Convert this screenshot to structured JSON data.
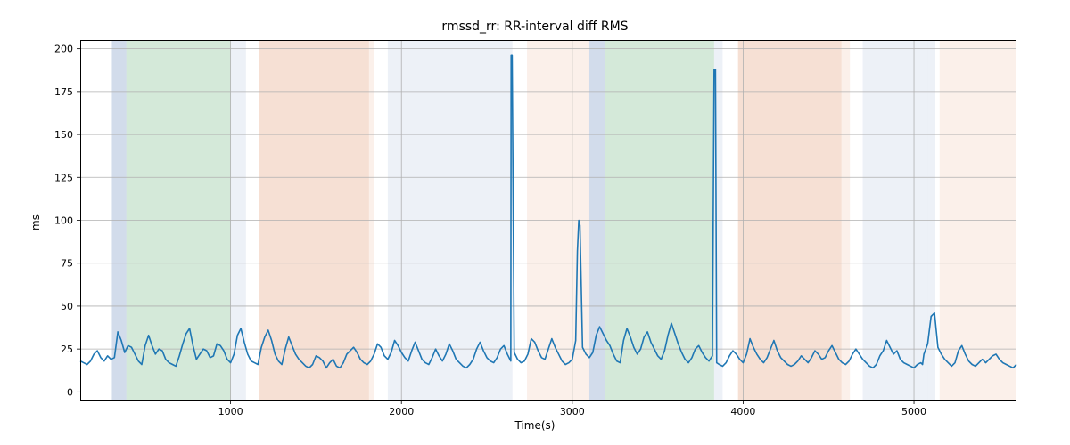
{
  "chart_data": {
    "type": "line",
    "title": "rmssd_rr: RR-interval diff RMS",
    "xlabel": "Time(s)",
    "ylabel": "ms",
    "xlim": [
      120,
      5600
    ],
    "ylim": [
      -5,
      205
    ],
    "xticks": [
      1000,
      2000,
      3000,
      4000,
      5000
    ],
    "yticks": [
      0,
      25,
      50,
      75,
      100,
      125,
      150,
      175,
      200
    ],
    "grid": true,
    "bands": [
      {
        "x0": 305,
        "x1": 390,
        "class": "band-blue"
      },
      {
        "x0": 390,
        "x1": 1000,
        "class": "band-green"
      },
      {
        "x0": 1000,
        "x1": 1090,
        "class": "band-lightblue"
      },
      {
        "x0": 1165,
        "x1": 1810,
        "class": "band-orange"
      },
      {
        "x0": 1810,
        "x1": 1840,
        "class": "band-lightorange"
      },
      {
        "x0": 1920,
        "x1": 2650,
        "class": "band-lightblue"
      },
      {
        "x0": 2735,
        "x1": 3100,
        "class": "band-lightorange"
      },
      {
        "x0": 3100,
        "x1": 3190,
        "class": "band-blue"
      },
      {
        "x0": 3190,
        "x1": 3830,
        "class": "band-green"
      },
      {
        "x0": 3830,
        "x1": 3880,
        "class": "band-lightblue"
      },
      {
        "x0": 3970,
        "x1": 4575,
        "class": "band-orange"
      },
      {
        "x0": 4575,
        "x1": 4625,
        "class": "band-lightorange"
      },
      {
        "x0": 4700,
        "x1": 5080,
        "class": "band-lightblue"
      },
      {
        "x0": 5080,
        "x1": 5125,
        "class": "band-lightblue"
      },
      {
        "x0": 5150,
        "x1": 5600,
        "class": "band-lightorange"
      }
    ],
    "series": [
      {
        "name": "rmssd_rr",
        "x": [
          120,
          140,
          160,
          180,
          200,
          220,
          240,
          260,
          280,
          300,
          320,
          340,
          360,
          380,
          400,
          420,
          440,
          460,
          480,
          500,
          520,
          540,
          560,
          580,
          600,
          620,
          640,
          660,
          680,
          700,
          720,
          740,
          760,
          780,
          800,
          820,
          840,
          860,
          880,
          900,
          920,
          940,
          960,
          980,
          1000,
          1020,
          1040,
          1060,
          1080,
          1100,
          1120,
          1140,
          1160,
          1180,
          1200,
          1220,
          1240,
          1260,
          1280,
          1300,
          1320,
          1340,
          1360,
          1380,
          1400,
          1420,
          1440,
          1460,
          1480,
          1500,
          1520,
          1540,
          1560,
          1580,
          1600,
          1620,
          1640,
          1660,
          1680,
          1700,
          1720,
          1740,
          1760,
          1780,
          1800,
          1820,
          1840,
          1860,
          1880,
          1900,
          1920,
          1940,
          1960,
          1980,
          2000,
          2020,
          2040,
          2060,
          2080,
          2100,
          2120,
          2140,
          2160,
          2180,
          2200,
          2220,
          2240,
          2260,
          2280,
          2300,
          2320,
          2340,
          2360,
          2380,
          2400,
          2420,
          2440,
          2460,
          2480,
          2500,
          2520,
          2540,
          2560,
          2580,
          2600,
          2620,
          2640,
          2642,
          2648,
          2660,
          2680,
          2700,
          2720,
          2740,
          2760,
          2780,
          2800,
          2820,
          2840,
          2860,
          2880,
          2900,
          2920,
          2940,
          2960,
          2980,
          3000,
          3020,
          3030,
          3038,
          3045,
          3060,
          3080,
          3100,
          3120,
          3140,
          3160,
          3180,
          3200,
          3220,
          3240,
          3260,
          3280,
          3300,
          3320,
          3340,
          3360,
          3380,
          3400,
          3420,
          3440,
          3460,
          3480,
          3500,
          3520,
          3540,
          3560,
          3580,
          3600,
          3620,
          3640,
          3660,
          3680,
          3700,
          3720,
          3740,
          3760,
          3780,
          3800,
          3820,
          3830,
          3838,
          3845,
          3860,
          3880,
          3900,
          3920,
          3940,
          3960,
          3980,
          4000,
          4020,
          4040,
          4060,
          4080,
          4100,
          4120,
          4140,
          4160,
          4180,
          4200,
          4220,
          4240,
          4260,
          4280,
          4300,
          4320,
          4340,
          4360,
          4380,
          4400,
          4420,
          4440,
          4460,
          4480,
          4500,
          4520,
          4540,
          4560,
          4580,
          4600,
          4620,
          4640,
          4660,
          4680,
          4700,
          4720,
          4740,
          4760,
          4780,
          4800,
          4820,
          4840,
          4860,
          4880,
          4900,
          4920,
          4940,
          4960,
          4980,
          5000,
          5020,
          5040,
          5050,
          5058,
          5080,
          5100,
          5120,
          5140,
          5160,
          5180,
          5200,
          5220,
          5240,
          5260,
          5280,
          5300,
          5320,
          5340,
          5360,
          5380,
          5400,
          5420,
          5440,
          5460,
          5480,
          5500,
          5520,
          5540,
          5560,
          5580,
          5600
        ],
        "y": [
          18,
          17,
          16,
          18,
          22,
          24,
          20,
          18,
          21,
          19,
          20,
          35,
          30,
          23,
          27,
          26,
          22,
          18,
          16,
          27,
          33,
          27,
          22,
          25,
          24,
          19,
          17,
          16,
          15,
          21,
          28,
          34,
          37,
          27,
          19,
          22,
          25,
          24,
          20,
          21,
          28,
          27,
          24,
          19,
          17,
          22,
          33,
          37,
          29,
          22,
          18,
          17,
          16,
          26,
          32,
          36,
          30,
          22,
          18,
          16,
          25,
          32,
          27,
          22,
          19,
          17,
          15,
          14,
          16,
          21,
          20,
          18,
          14,
          17,
          19,
          15,
          14,
          17,
          22,
          24,
          26,
          23,
          19,
          17,
          16,
          18,
          22,
          28,
          26,
          21,
          19,
          23,
          30,
          27,
          23,
          20,
          18,
          24,
          29,
          24,
          19,
          17,
          16,
          20,
          25,
          21,
          18,
          22,
          28,
          24,
          19,
          17,
          15,
          14,
          16,
          19,
          25,
          29,
          24,
          20,
          18,
          17,
          20,
          25,
          27,
          22,
          18,
          196,
          196,
          23,
          19,
          17,
          18,
          22,
          31,
          29,
          24,
          20,
          19,
          25,
          31,
          26,
          22,
          18,
          16,
          17,
          19,
          30,
          82,
          100,
          97,
          26,
          22,
          20,
          23,
          33,
          38,
          34,
          30,
          27,
          22,
          18,
          17,
          30,
          37,
          32,
          26,
          22,
          25,
          32,
          35,
          29,
          25,
          21,
          19,
          24,
          33,
          40,
          34,
          28,
          23,
          19,
          17,
          20,
          25,
          27,
          23,
          20,
          18,
          21,
          188,
          188,
          17,
          16,
          15,
          17,
          21,
          24,
          22,
          19,
          17,
          22,
          31,
          26,
          22,
          19,
          17,
          20,
          25,
          30,
          24,
          20,
          18,
          16,
          15,
          16,
          18,
          21,
          19,
          17,
          20,
          24,
          22,
          19,
          20,
          24,
          27,
          23,
          19,
          17,
          16,
          18,
          22,
          25,
          22,
          19,
          17,
          15,
          14,
          16,
          21,
          24,
          30,
          26,
          22,
          24,
          19,
          17,
          16,
          15,
          14,
          16,
          17,
          16,
          22,
          28,
          44,
          46,
          26,
          22,
          19,
          17,
          15,
          17,
          24,
          27,
          22,
          18,
          16,
          15,
          17,
          19,
          17,
          19,
          21,
          22,
          19,
          17,
          16,
          15,
          14,
          16
        ]
      }
    ]
  }
}
